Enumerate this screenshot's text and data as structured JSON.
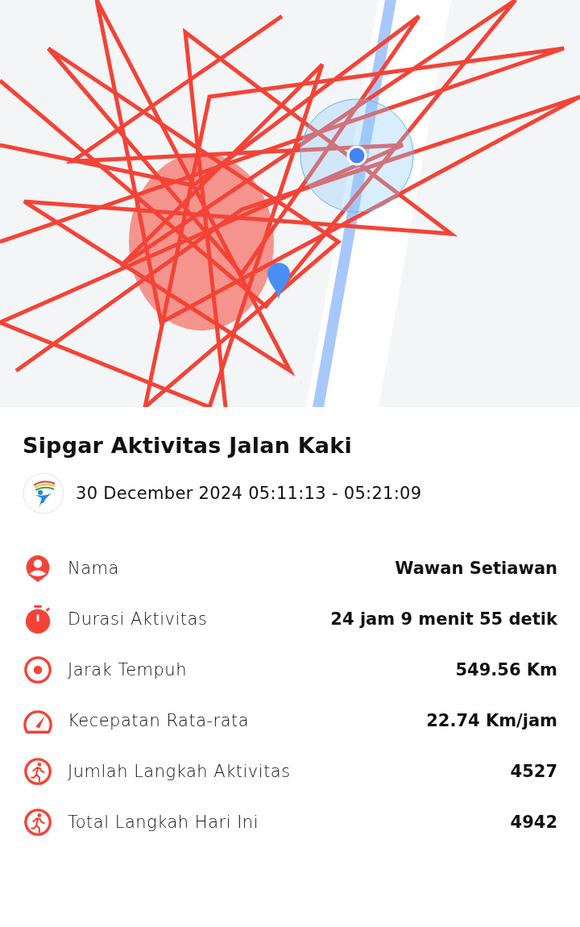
{
  "title": "Sipgar Aktivitas Jalan Kaki",
  "datetime": "30 December 2024 05:11:13 - 05:21:09",
  "stats": [
    {
      "kind": "person",
      "label": "Nama",
      "value": "Wawan Setiawan"
    },
    {
      "kind": "timer",
      "label": "Durasi Aktivitas",
      "value": "24 jam 9 menit 55 detik"
    },
    {
      "kind": "target",
      "label": "Jarak Tempuh",
      "value": "549.56 Km"
    },
    {
      "kind": "speed",
      "label": "Kecepatan Rata-rata",
      "value": "22.74 Km/jam"
    },
    {
      "kind": "walk",
      "label": "Jumlah Langkah Aktivitas",
      "value": "4527"
    },
    {
      "kind": "walk",
      "label": "Total Langkah Hari Ini",
      "value": "4942"
    }
  ]
}
